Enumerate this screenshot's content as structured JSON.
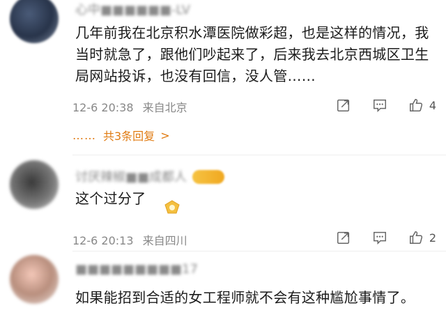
{
  "comments": [
    {
      "username": "心中■■■■■■-LV",
      "text": "几年前我在北京积水潭医院做彩超，也是这样的情况，我当时就急了，跟他们吵起来了，后来我去北京西城区卫生局网站投诉，也没有回信，没人管……",
      "time": "12-6 20:38",
      "location": "来自北京",
      "likes": "4",
      "replies_dots": "……",
      "replies_label": "共3条回复",
      "replies_arrow": ">"
    },
    {
      "username": "讨厌辣椒■■成都人",
      "badge": "金粉",
      "text": "这个过分了",
      "time": "12-6 20:13",
      "location": "来自四川",
      "likes": "2"
    },
    {
      "username": "■■■■■■■■■17",
      "text": "如果能招到合适的女工程师就不会有这种尴尬事情了。"
    }
  ],
  "icons": {
    "share": "share-icon",
    "comment": "comment-icon",
    "like": "thumbs-up-icon"
  },
  "colors": {
    "accent": "#e07b12",
    "meta": "#888888"
  }
}
